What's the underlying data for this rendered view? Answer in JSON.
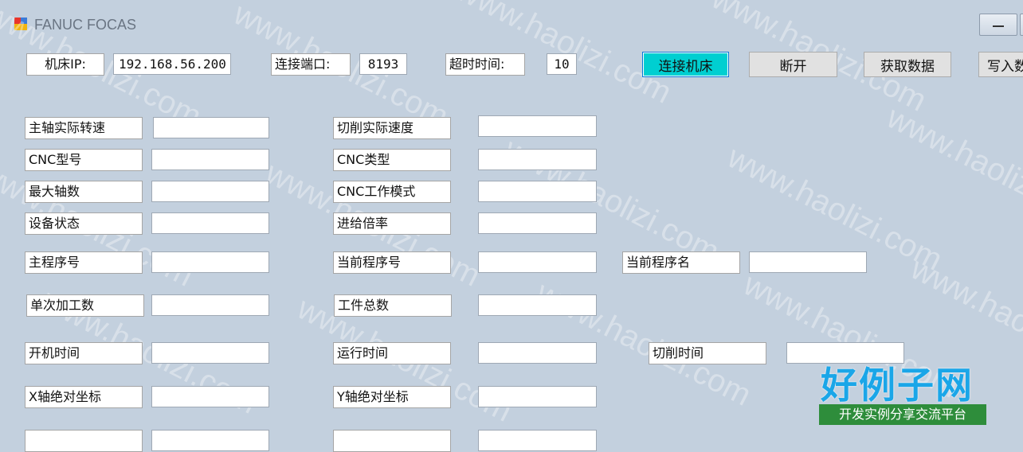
{
  "window": {
    "title": "FANUC FOCAS"
  },
  "toolbar": {
    "ip_label": "机床IP:",
    "ip_value": "192.168.56.200",
    "port_label": "连接端口:",
    "port_value": "8193",
    "timeout_label": "超时时间:",
    "timeout_value": "10",
    "connect_label": "连接机床",
    "disconnect_label": "断开",
    "fetch_label": "获取数据",
    "write_label": "写入数"
  },
  "fields": {
    "spindle_speed": "主轴实际转速",
    "cut_speed": "切削实际速度",
    "cnc_model": "CNC型号",
    "cnc_type": "CNC类型",
    "max_axes": "最大轴数",
    "cnc_mode": "CNC工作模式",
    "device_status": "设备状态",
    "feed_rate": "进给倍率",
    "main_prog_no": "主程序号",
    "cur_prog_no": "当前程序号",
    "cur_prog_name": "当前程序名",
    "single_count": "单次加工数",
    "total_parts": "工件总数",
    "power_on_time": "开机时间",
    "run_time": "运行时间",
    "cut_time": "切削时间",
    "x_abs": "X轴绝对坐标",
    "y_abs": "Y轴绝对坐标"
  },
  "watermark": {
    "text": "www.haolizi.com",
    "logo_title": "好例子网",
    "logo_subtitle": "开发实例分享交流平台"
  }
}
